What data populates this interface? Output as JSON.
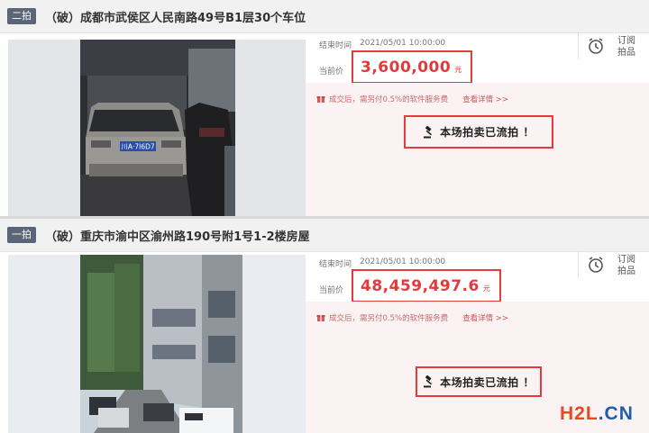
{
  "listings": [
    {
      "round": "二拍",
      "title": "（破）成都市武侯区人民南路49号B1层30个车位",
      "end_label": "结束时间",
      "end_time": "2021/05/01 10:00:00",
      "price_label": "当前价",
      "price": "3,600,000",
      "price_unit": "元",
      "subscribe": "订阅拍品",
      "fee_text": "成交后，需另付0.5%的软件服务费",
      "fee_link": "查看详情 >>",
      "status": "本场拍卖已流拍 ！",
      "plate": "川A·7I6D7"
    },
    {
      "round": "一拍",
      "title": "（破）重庆市渝中区渝州路190号附1号1-2楼房屋",
      "end_label": "结束时间",
      "end_time": "2021/05/01 10:00:00",
      "price_label": "当前价",
      "price": "48,459,497.6",
      "price_unit": "元",
      "subscribe": "订阅拍品",
      "fee_text": "成交后，需另付0.5%的软件服务费",
      "fee_link": "查看详情 >>",
      "status": "本场拍卖已流拍 ！"
    }
  ],
  "watermark": {
    "part1": "H2L",
    "part2": ".CN",
    "colors": {
      "h2l": "#e8491d",
      "cn": "#1e5fa8"
    }
  },
  "colors": {
    "accent_red": "#e43b3b",
    "price_red": "#e4393c",
    "band": "#fbf3f3"
  }
}
